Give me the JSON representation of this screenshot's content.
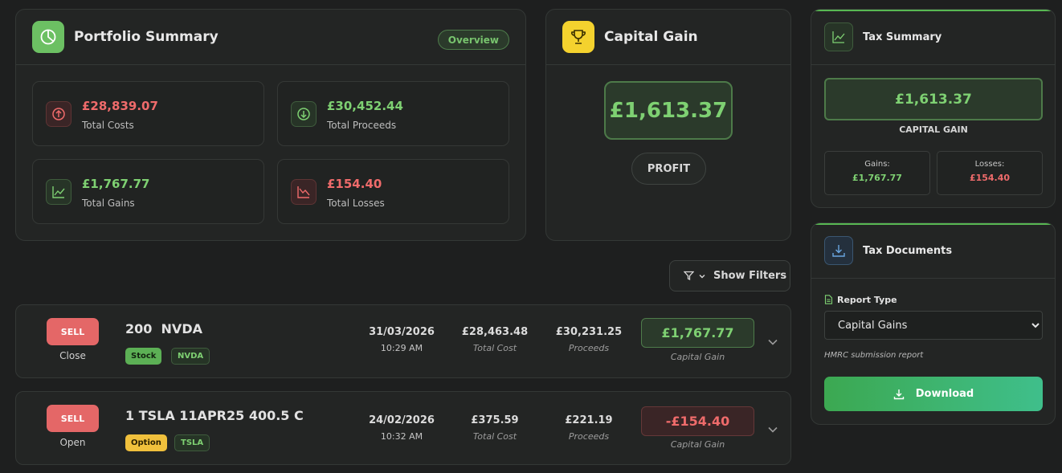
{
  "portfolio": {
    "title": "Portfolio Summary",
    "badge": "Overview",
    "stats": [
      {
        "value": "£28,839.07",
        "label": "Total Costs"
      },
      {
        "value": "£30,452.44",
        "label": "Total Proceeds"
      },
      {
        "value": "£1,767.77",
        "label": "Total Gains"
      },
      {
        "value": "£154.40",
        "label": "Total Losses"
      }
    ]
  },
  "capital_gain": {
    "title": "Capital Gain",
    "amount": "£1,613.37",
    "status": "PROFIT"
  },
  "tax_summary": {
    "title": "Tax Summary",
    "amount": "£1,613.37",
    "amount_label": "CAPITAL GAIN",
    "gains_label": "Gains:",
    "gains_value": "£1,767.77",
    "losses_label": "Losses:",
    "losses_value": "£154.40"
  },
  "tax_documents": {
    "title": "Tax Documents",
    "report_type_label": "Report Type",
    "report_type_selected": "Capital Gains",
    "hint": "HMRC submission report",
    "download_label": "Download"
  },
  "filters": {
    "label": "Show Filters"
  },
  "trades": [
    {
      "action": "SELL",
      "position": "Close",
      "title": "200  NVDA",
      "type_tag": "Stock",
      "symbol_tag": "NVDA",
      "date": "31/03/2026",
      "time": "10:29 AM",
      "total_cost": "£28,463.48",
      "total_cost_label": "Total Cost",
      "proceeds": "£30,231.25",
      "proceeds_label": "Proceeds",
      "gain": "£1,767.77",
      "gain_label": "Capital Gain"
    },
    {
      "action": "SELL",
      "position": "Open",
      "title": "1 TSLA 11APR25 400.5 C",
      "type_tag": "Option",
      "symbol_tag": "TSLA",
      "date": "24/02/2026",
      "time": "10:32 AM",
      "total_cost": "£375.59",
      "total_cost_label": "Total Cost",
      "proceeds": "£221.19",
      "proceeds_label": "Proceeds",
      "gain": "-£154.40",
      "gain_label": "Capital Gain"
    }
  ],
  "colors": {
    "accent_green": "#7ed072",
    "loss_red": "#ef6b6b",
    "sell_red": "#e46767",
    "trophy_yellow": "#f4d22e"
  }
}
